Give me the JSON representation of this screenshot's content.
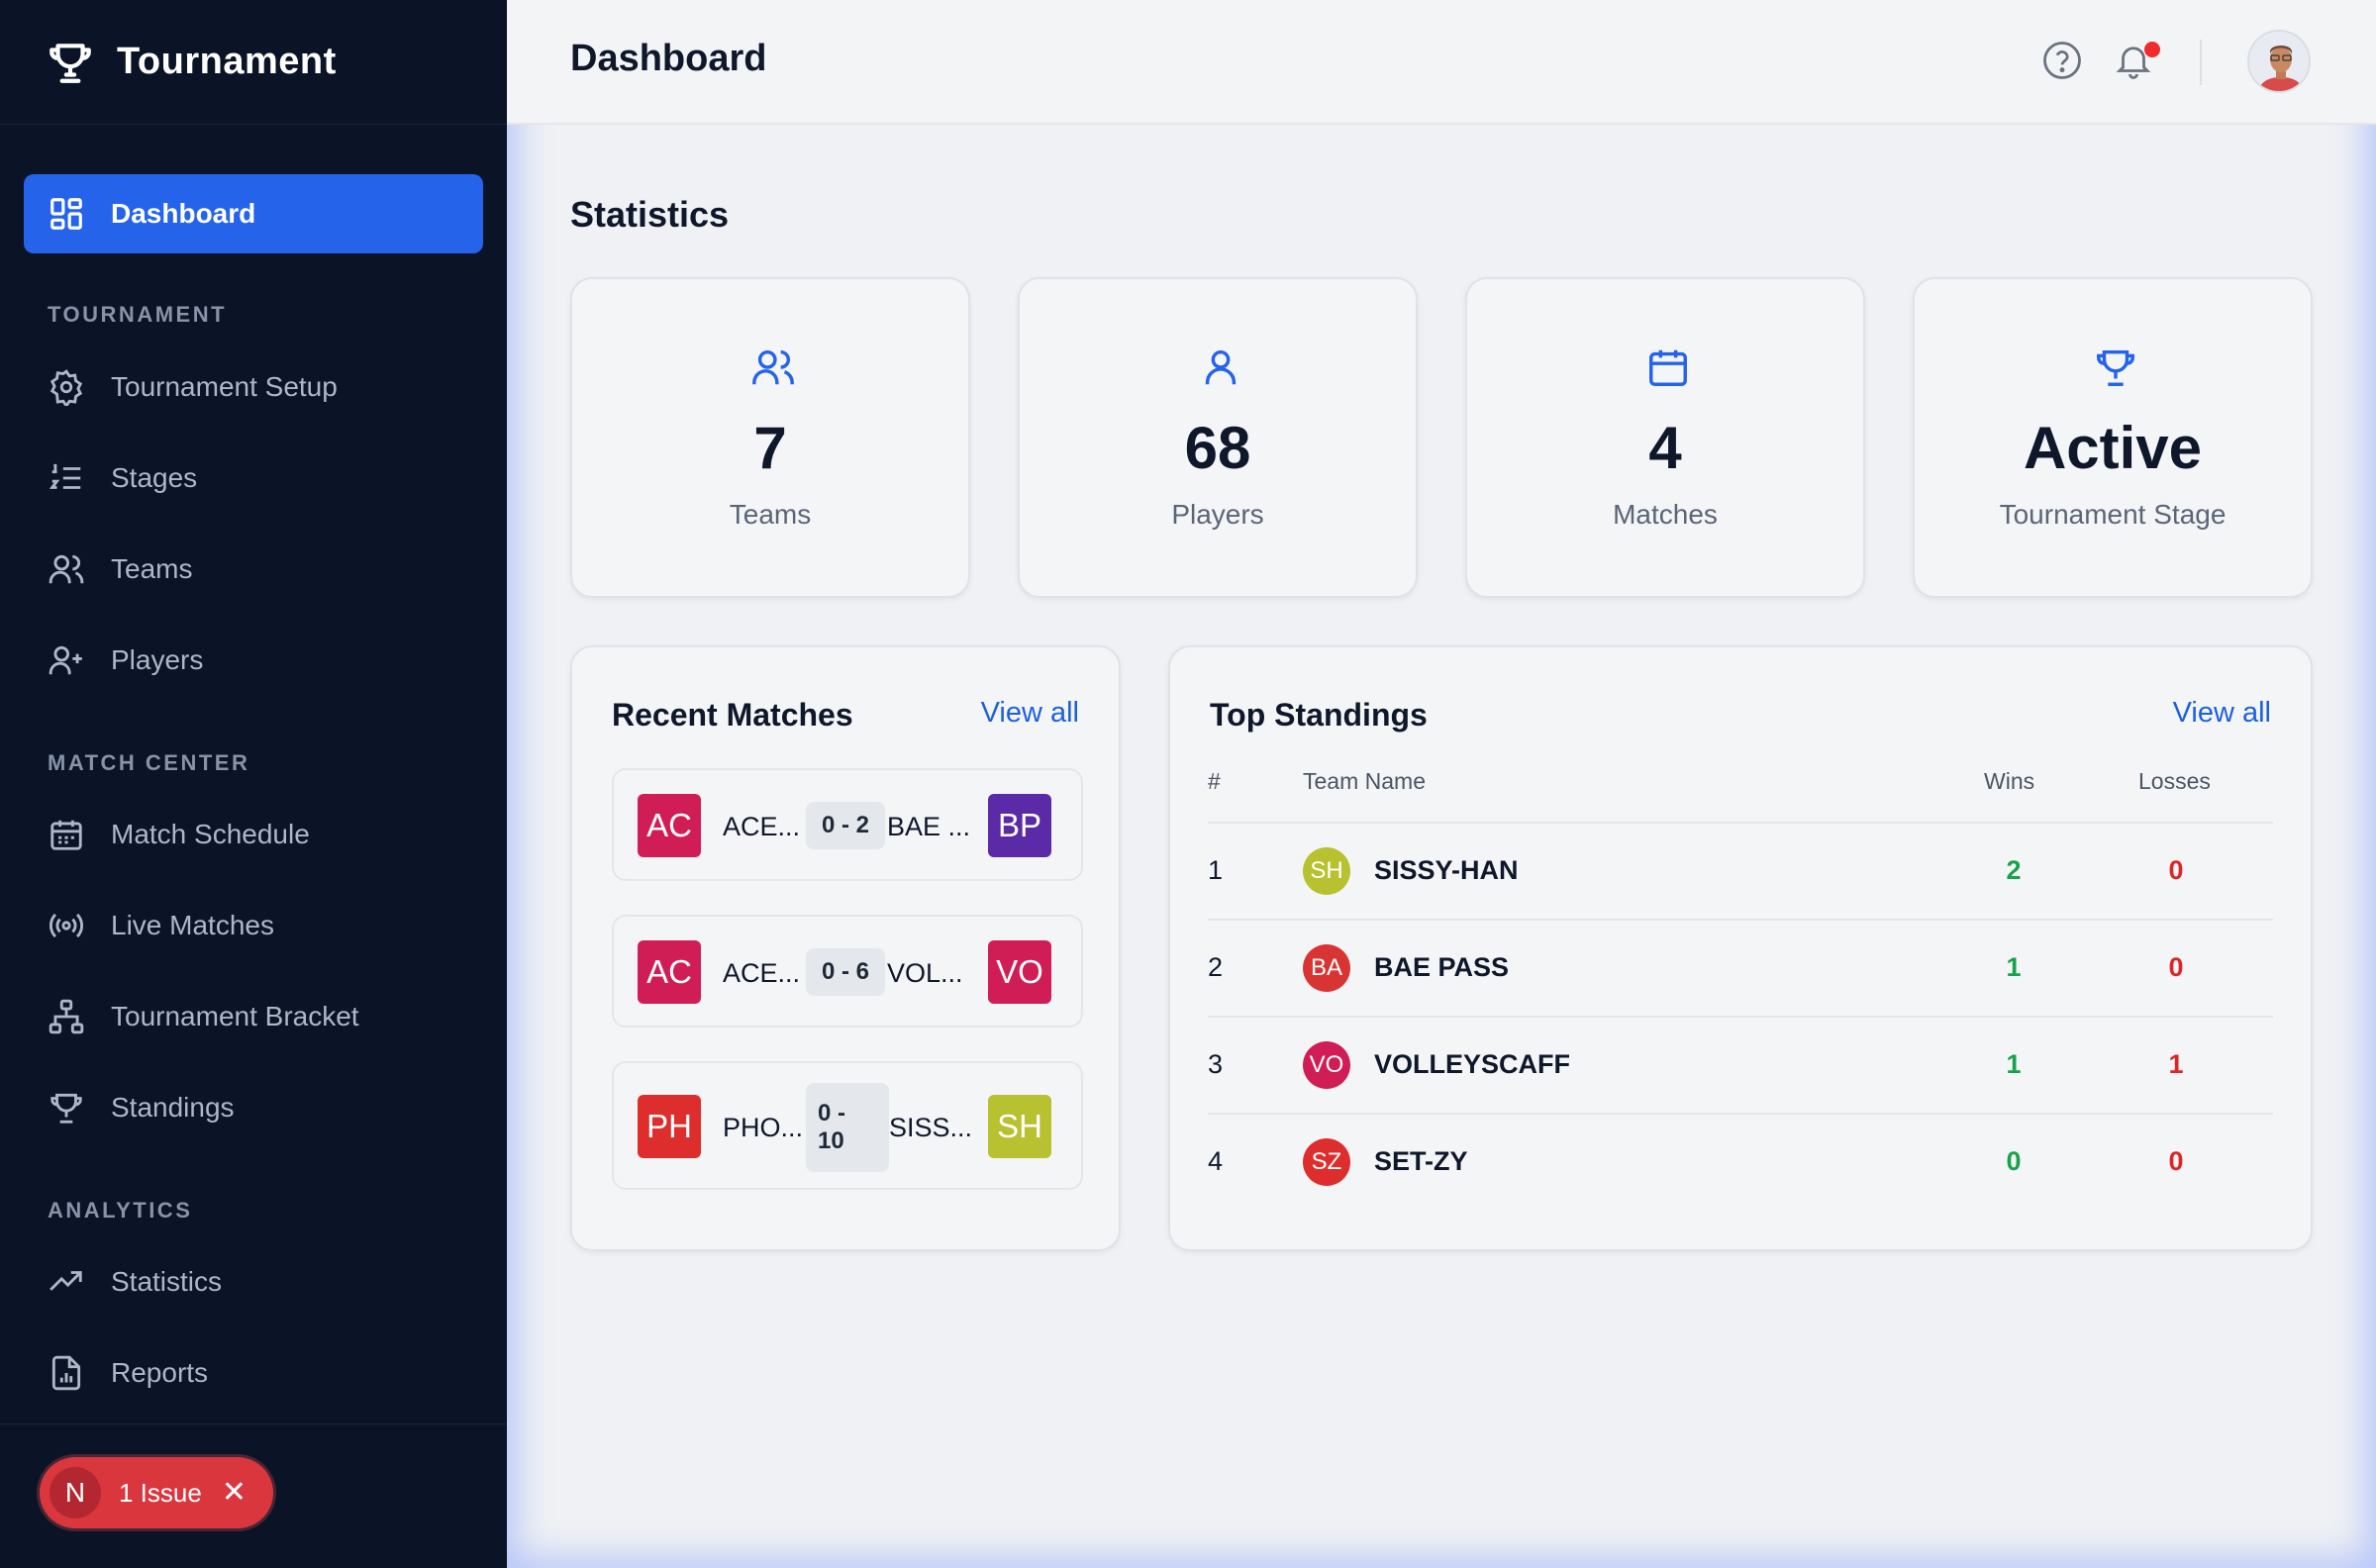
{
  "app": {
    "title": "Tournament"
  },
  "sidebar": {
    "active": {
      "label": "Dashboard",
      "icon": "dashboard-grid-icon"
    },
    "sections": [
      {
        "title": "TOURNAMENT",
        "items": [
          {
            "label": "Tournament Setup",
            "icon": "gear-icon"
          },
          {
            "label": "Stages",
            "icon": "numbered-list-icon"
          },
          {
            "label": "Teams",
            "icon": "users-icon"
          },
          {
            "label": "Players",
            "icon": "user-plus-icon"
          }
        ]
      },
      {
        "title": "MATCH CENTER",
        "items": [
          {
            "label": "Match Schedule",
            "icon": "calendar-icon"
          },
          {
            "label": "Live Matches",
            "icon": "broadcast-icon"
          },
          {
            "label": "Tournament Bracket",
            "icon": "bracket-icon"
          },
          {
            "label": "Standings",
            "icon": "trophy-icon"
          }
        ]
      },
      {
        "title": "ANALYTICS",
        "items": [
          {
            "label": "Statistics",
            "icon": "trending-up-icon"
          },
          {
            "label": "Reports",
            "icon": "report-file-icon"
          }
        ]
      }
    ],
    "issue": {
      "badge": "N",
      "label": "1 Issue",
      "close": "✕"
    }
  },
  "header": {
    "title": "Dashboard"
  },
  "statistics": {
    "heading": "Statistics",
    "cards": [
      {
        "value": "7",
        "label": "Teams",
        "icon": "users-icon"
      },
      {
        "value": "68",
        "label": "Players",
        "icon": "user-icon"
      },
      {
        "value": "4",
        "label": "Matches",
        "icon": "calendar-icon"
      },
      {
        "value": "Active",
        "label": "Tournament Stage",
        "icon": "trophy-icon"
      }
    ]
  },
  "recent_matches": {
    "title": "Recent Matches",
    "view_all": "View all",
    "matches": [
      {
        "home_abbr": "AC",
        "home_color": "#d11d55",
        "home_name": "ACE...",
        "score": "0 - 2",
        "away_name": "BAE ...",
        "away_abbr": "BP",
        "away_color": "#5b2aa6"
      },
      {
        "home_abbr": "AC",
        "home_color": "#d11d55",
        "home_name": "ACE...",
        "score": "0 - 6",
        "away_name": "VOL...",
        "away_abbr": "VO",
        "away_color": "#d11d55"
      },
      {
        "home_abbr": "PH",
        "home_color": "#de2d2d",
        "home_name": "PHO...",
        "score_line1": "0 -",
        "score_line2": "10",
        "away_name": "SISS...",
        "away_abbr": "SH",
        "away_color": "#b8c12f"
      }
    ]
  },
  "standings": {
    "title": "Top Standings",
    "view_all": "View all",
    "columns": {
      "rank": "#",
      "team": "Team Name",
      "wins": "Wins",
      "losses": "Losses"
    },
    "rows": [
      {
        "rank": "1",
        "abbr": "SH",
        "color": "#b8c12f",
        "name": "SISSY-HAN",
        "wins": "2",
        "losses": "0"
      },
      {
        "rank": "2",
        "abbr": "BA",
        "color": "#d93434",
        "name": "BAE PASS",
        "wins": "1",
        "losses": "0"
      },
      {
        "rank": "3",
        "abbr": "VO",
        "color": "#d11d55",
        "name": "VOLLEYSCAFF",
        "wins": "1",
        "losses": "1"
      },
      {
        "rank": "4",
        "abbr": "SZ",
        "color": "#de2d2d",
        "name": "SET-ZY",
        "wins": "0",
        "losses": "0"
      }
    ]
  }
}
